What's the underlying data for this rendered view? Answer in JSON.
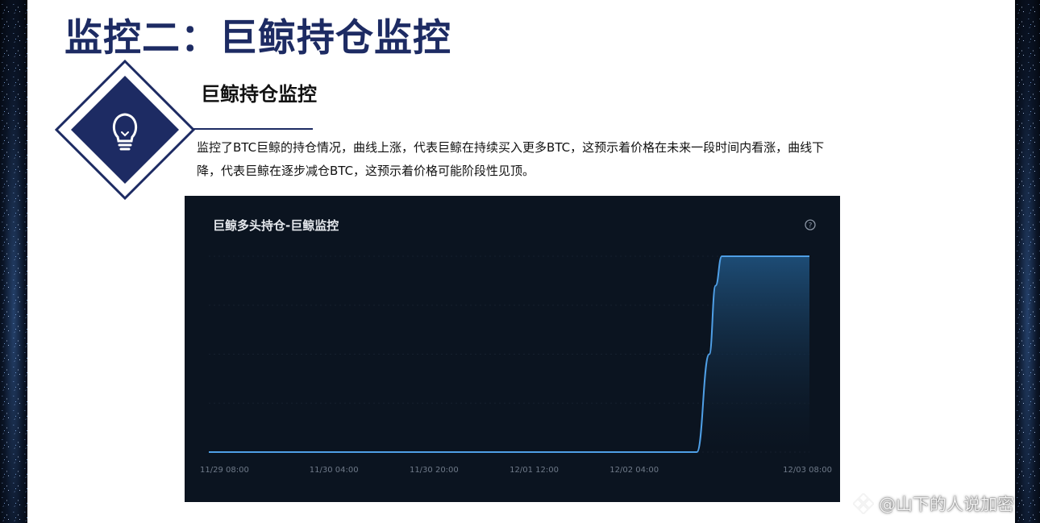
{
  "slide": {
    "title": "监控二：巨鲸持仓监控",
    "subtitle": "巨鲸持仓监控",
    "description": "监控了BTC巨鲸的持仓情况，曲线上涨，代表巨鲸在持续买入更多BTC，这预示着价格在未来一段时间内看涨，曲线下降，代表巨鲸在逐步减仓BTC，这预示着价格可能阶段性见顶。",
    "decoration_icon": "lightbulb-icon"
  },
  "chart_data": {
    "type": "area",
    "title": "巨鲸多头持仓-巨鲸监控",
    "help_icon": "question-circle-icon",
    "xlabel": "",
    "ylabel": "",
    "x_ticks": [
      "11/29 08:00",
      "11/30 04:00",
      "11/30 20:00",
      "12/01 12:00",
      "12/02 04:00",
      "12/03 08:00"
    ],
    "x": [
      "11/29 08:00",
      "11/30 04:00",
      "11/30 20:00",
      "12/01 12:00",
      "12/02 04:00",
      "12/02 14:00",
      "12/02 16:00",
      "12/02 17:00",
      "12/02 18:00",
      "12/03 08:00"
    ],
    "series": [
      {
        "values": [
          0,
          0,
          0,
          0,
          0,
          0,
          0.5,
          0.85,
          1,
          1
        ]
      }
    ],
    "y_ticks_shown": false,
    "grid": true,
    "line_color": "#4f9fe6",
    "background": "#0b1420"
  },
  "watermark": {
    "text": "@山下的人说加密",
    "icon": "binance-logo-icon"
  }
}
